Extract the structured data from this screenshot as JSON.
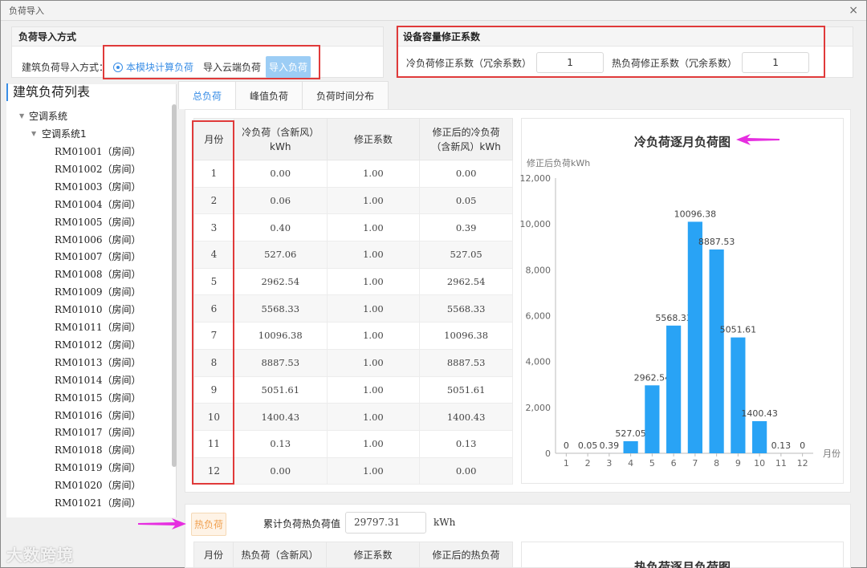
{
  "window": {
    "title": "负荷导入",
    "close_glyph": "×"
  },
  "load_import": {
    "section_title": "负荷导入方式",
    "mode_label": "建筑负荷导入方式：",
    "options": [
      "本模块计算负荷",
      "导入云端负荷"
    ],
    "selected": "本模块计算负荷",
    "import_button": "导入负荷"
  },
  "capacity": {
    "section_title": "设备容量修正系数",
    "cold_label": "冷负荷修正系数（冗余系数）",
    "cold_value": "1",
    "heat_label": "热负荷修正系数（冗余系数）",
    "heat_value": "1"
  },
  "tree": {
    "title": "建筑负荷列表",
    "root": "空调系统",
    "system": "空调系统1",
    "rooms": [
      "RM01001（房间）",
      "RM01002（房间）",
      "RM01003（房间）",
      "RM01004（房间）",
      "RM01005（房间）",
      "RM01006（房间）",
      "RM01007（房间）",
      "RM01008（房间）",
      "RM01009（房间）",
      "RM01010（房间）",
      "RM01011（房间）",
      "RM01012（房间）",
      "RM01013（房间）",
      "RM01014（房间）",
      "RM01015（房间）",
      "RM01016（房间）",
      "RM01017（房间）",
      "RM01018（房间）",
      "RM01019（房间）",
      "RM01020（房间）",
      "RM01021（房间）"
    ]
  },
  "tabs": [
    "总负荷",
    "峰值负荷",
    "负荷时间分布"
  ],
  "active_tab": "总负荷",
  "cold_table": {
    "headers": [
      "月份",
      "冷负荷（含新风）kWh",
      "修正系数",
      "修正后的冷负荷（含新风）kWh"
    ],
    "rows": [
      [
        "1",
        "0.00",
        "1.00",
        "0.00"
      ],
      [
        "2",
        "0.06",
        "1.00",
        "0.05"
      ],
      [
        "3",
        "0.40",
        "1.00",
        "0.39"
      ],
      [
        "4",
        "527.06",
        "1.00",
        "527.05"
      ],
      [
        "5",
        "2962.54",
        "1.00",
        "2962.54"
      ],
      [
        "6",
        "5568.33",
        "1.00",
        "5568.33"
      ],
      [
        "7",
        "10096.38",
        "1.00",
        "10096.38"
      ],
      [
        "8",
        "8887.53",
        "1.00",
        "8887.53"
      ],
      [
        "9",
        "5051.61",
        "1.00",
        "5051.61"
      ],
      [
        "10",
        "1400.43",
        "1.00",
        "1400.43"
      ],
      [
        "11",
        "0.13",
        "1.00",
        "0.13"
      ],
      [
        "12",
        "0.00",
        "1.00",
        "0.00"
      ]
    ]
  },
  "chart_data": {
    "type": "bar",
    "title": "冷负荷逐月负荷图",
    "ylabel": "修正后负荷kWh",
    "xlabel": "月份",
    "categories": [
      "1",
      "2",
      "3",
      "4",
      "5",
      "6",
      "7",
      "8",
      "9",
      "10",
      "11",
      "12"
    ],
    "values": [
      0,
      0.05,
      0.39,
      527.05,
      2962.54,
      5568.33,
      10096.38,
      8887.53,
      5051.61,
      1400.43,
      0.13,
      0
    ],
    "data_labels": [
      "0",
      "0.05",
      "0.39",
      "527.05",
      "2962.54",
      "5568.33",
      "10096.38",
      "8887.53",
      "5051.61",
      "1400.43",
      "0.13",
      "0"
    ],
    "yticks": [
      "0",
      "2,000",
      "4,000",
      "6,000",
      "8,000",
      "10,000",
      "12,000"
    ],
    "ylim": [
      0,
      12000
    ],
    "bar_color": "#29a3f5",
    "grid": false
  },
  "heat": {
    "badge": "热负荷",
    "total_label": "累计负荷热负荷值",
    "total_value": "29797.31",
    "unit": "kWh",
    "headers": [
      "月份",
      "热负荷（含新风）",
      "修正系数",
      "修正后的热负荷"
    ],
    "chart_title": "热负荷逐月负荷图"
  },
  "watermark": "大数跨境",
  "colors": {
    "accent": "#3a8ee6",
    "highlight": "#e03a3a",
    "arrow": "#e62ee0"
  }
}
